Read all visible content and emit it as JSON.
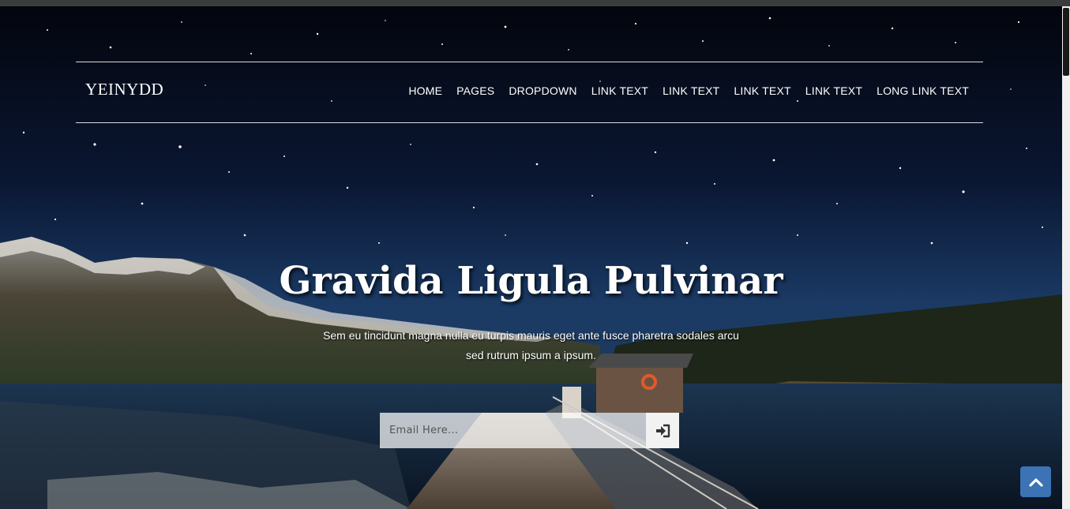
{
  "brand": {
    "name": "YEINYDD"
  },
  "nav": {
    "items": [
      {
        "label": "HOME"
      },
      {
        "label": "PAGES"
      },
      {
        "label": "DROPDOWN"
      },
      {
        "label": "LINK TEXT"
      },
      {
        "label": "LINK TEXT"
      },
      {
        "label": "LINK TEXT"
      },
      {
        "label": "LINK TEXT"
      },
      {
        "label": "LONG LINK TEXT"
      }
    ]
  },
  "hero": {
    "headline": "Gravida Ligula Pulvinar",
    "subtext": "Sem eu tincidunt magna nulla eu turpis mauris eget ante fusce pharetra sodales arcu sed rutrum ipsum a ipsum."
  },
  "subscribe": {
    "placeholder": "Email Here...",
    "submit_icon": "sign-in-icon"
  },
  "back_to_top": {
    "icon": "chevron-up-icon",
    "color": "#3b73b5"
  }
}
